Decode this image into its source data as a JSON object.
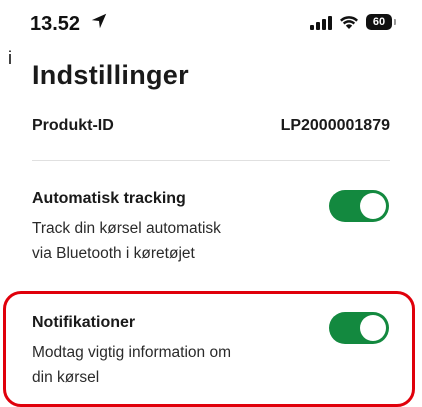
{
  "status_bar": {
    "time": "13.52",
    "battery": "60",
    "location_icon": "location-arrow-icon",
    "signal_icon": "cell-signal-icon",
    "wifi_icon": "wifi-icon"
  },
  "edge_char": "i",
  "page": {
    "title": "Indstillinger"
  },
  "product": {
    "label": "Produkt-ID",
    "value": "LP2000001879"
  },
  "settings": [
    {
      "title": "Automatisk tracking",
      "description_line1": "Track din kørsel automatisk",
      "description_line2": "via Bluetooth i køretøjet",
      "enabled": true
    },
    {
      "title": "Notifikationer",
      "description_line1": "Modtag vigtig information om",
      "description_line2": "din kørsel",
      "enabled": true
    }
  ],
  "colors": {
    "toggle_on": "#13893f",
    "highlight": "#e0000b"
  }
}
